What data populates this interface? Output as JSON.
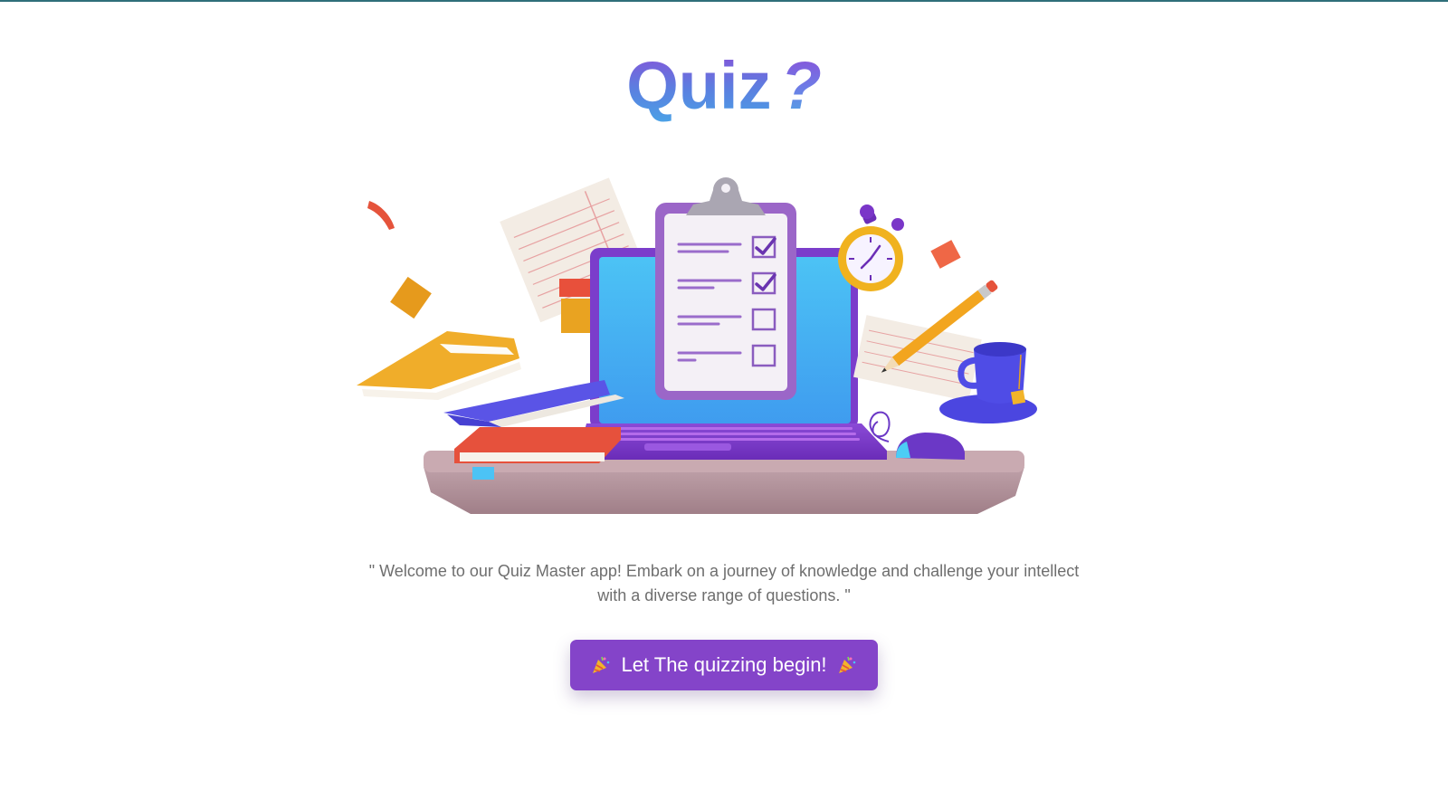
{
  "header": {
    "title": "Quiz",
    "title_mark": "?"
  },
  "hero": {
    "icon": "quiz-laptop-clipboard-illustration"
  },
  "intro": {
    "text": "\" Welcome to our Quiz Master app! Embark on a journey of knowledge and challenge your intellect with a diverse range of questions. \""
  },
  "start": {
    "label": "Let The quizzing begin!",
    "icon": "party-popper-icon"
  },
  "colors": {
    "accent": "#8444c9",
    "title_gradient_start": "#8a4fd8",
    "title_gradient_end": "#4aa2e6",
    "body_text": "#6e6e6e"
  }
}
